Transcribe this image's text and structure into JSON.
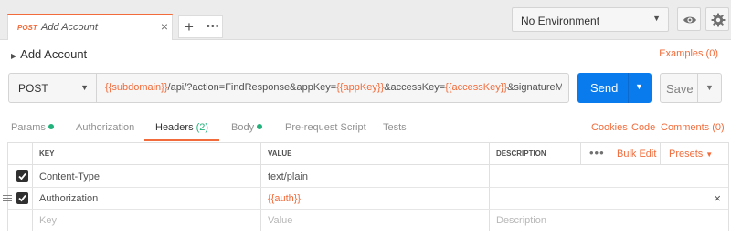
{
  "tab": {
    "method": "POST",
    "title": "Add Account",
    "close_icon": "×",
    "add_icon": "+",
    "more_icon": "•••"
  },
  "environment": {
    "selected": "No Environment",
    "caret_icon": "▼",
    "eye_icon": "eye-icon",
    "settings_icon": "gear-icon"
  },
  "request": {
    "arrow_icon": "▶",
    "name": "Add Account",
    "examples": "Examples (0)",
    "method": "POST",
    "method_caret": "▼",
    "url": {
      "var1": "{{subdomain}}",
      "text1": "/api/?action=FindResponse&appKey=",
      "var2": "{{appKey}}",
      "text2": "&accessKey=",
      "var3": "{{accessKey}}",
      "text3": "&signatureMetho..."
    },
    "send_label": "Send",
    "send_caret": "▼",
    "save_label": "Save",
    "save_caret": "▼"
  },
  "subtabs": {
    "params": "Params",
    "authorization": "Authorization",
    "headers": "Headers",
    "headers_count": "(2)",
    "body": "Body",
    "pre_request": "Pre-request Script",
    "tests": "Tests",
    "cookies": "Cookies",
    "code": "Code",
    "comments": "Comments (0)"
  },
  "headers_table": {
    "columns": {
      "key": "KEY",
      "value": "VALUE",
      "description": "DESCRIPTION"
    },
    "more_icon": "•••",
    "bulk_edit": "Bulk Edit",
    "presets": "Presets",
    "presets_caret": "▼",
    "rows": [
      {
        "checked": true,
        "key": "Content-Type",
        "value": "text/plain",
        "description": ""
      },
      {
        "checked": true,
        "key": "Authorization",
        "value": "{{auth}}",
        "description": "",
        "close_icon": "×"
      }
    ],
    "placeholder": {
      "key": "Key",
      "value": "Value",
      "description": "Description"
    }
  },
  "colors": {
    "accent": "#f26b3a",
    "send": "#097bed",
    "indicator": "#20b27a"
  }
}
